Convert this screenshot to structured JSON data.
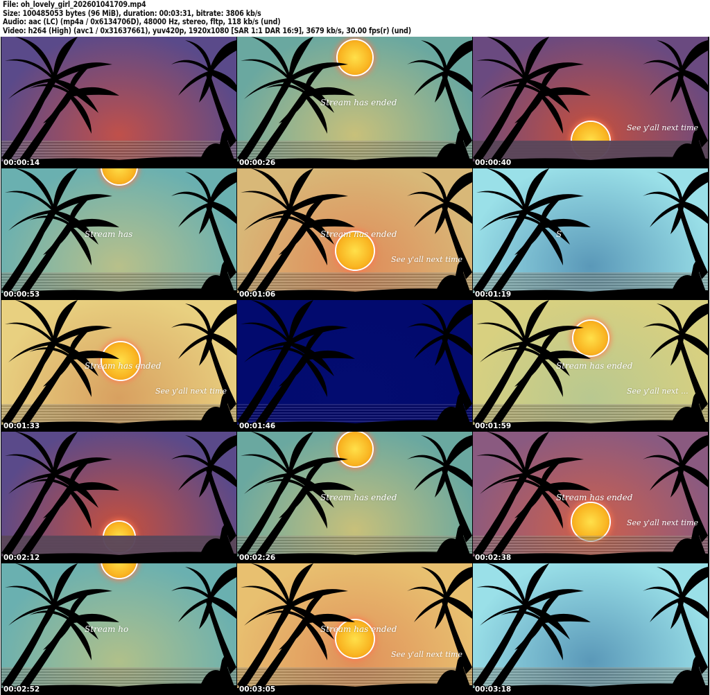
{
  "header": {
    "file": "File: oh_lovely_girl_202601041709.mp4",
    "size": "Size: 100485053 bytes (96 MiB), duration: 00:03:31, bitrate: 3806 kb/s",
    "audio": "Audio: aac (LC) (mp4a / 0x6134706D), 48000 Hz, stereo, fltp, 118 kb/s (und)",
    "video": "Video: h264 (High) (avc1 / 0x31637661), yuv420p, 1920x1080 [SAR 1:1 DAR 16:9], 3679 kb/s, 30.00 fps(r) (und)"
  },
  "thumbnails": [
    {
      "timestamp": "00:00:14",
      "caption1": "",
      "caption2": "",
      "sky": [
        "#5a4a8a",
        "#c0504a"
      ]
    },
    {
      "timestamp": "00:00:26",
      "caption1": "Stream has ended",
      "caption2": "",
      "sky": [
        "#6aa8a0",
        "#c8c07a"
      ]
    },
    {
      "timestamp": "00:00:40",
      "caption1": "",
      "caption2": "See y'all next time",
      "sky": [
        "#6a4a80",
        "#c8503c"
      ]
    },
    {
      "timestamp": "00:00:53",
      "caption1": "Stream has",
      "caption2": "",
      "sky": [
        "#6ab0b0",
        "#b8c08a"
      ]
    },
    {
      "timestamp": "00:01:06",
      "caption1": "Stream has ended",
      "caption2": "See y'all next time",
      "sky": [
        "#d8b878",
        "#e08a58"
      ]
    },
    {
      "timestamp": "00:01:19",
      "caption1": "S",
      "caption2": "",
      "sky": [
        "#9ae0e8",
        "#5a98b8"
      ]
    },
    {
      "timestamp": "00:01:33",
      "caption1": "Stream has ended",
      "caption2": "See y'all next time",
      "sky": [
        "#e8d080",
        "#d8a060"
      ]
    },
    {
      "timestamp": "00:01:46",
      "caption1": "",
      "caption2": "",
      "sky": [
        "#020a6e",
        "#030c70"
      ]
    },
    {
      "timestamp": "00:01:59",
      "caption1": "Stream has ended",
      "caption2": "See y'all next ...",
      "sky": [
        "#d8d080",
        "#b8c890"
      ]
    },
    {
      "timestamp": "00:02:12",
      "caption1": "",
      "caption2": "",
      "sky": [
        "#5a4a8a",
        "#c8503c"
      ]
    },
    {
      "timestamp": "00:02:26",
      "caption1": "Stream has ended",
      "caption2": "",
      "sky": [
        "#6aa8a0",
        "#c8c07a"
      ]
    },
    {
      "timestamp": "00:02:38",
      "caption1": "Stream has ended",
      "caption2": "See y'all next time",
      "sky": [
        "#8a5a80",
        "#d0604a"
      ]
    },
    {
      "timestamp": "00:02:52",
      "caption1": "Stream ho",
      "caption2": "",
      "sky": [
        "#6ab0b0",
        "#b0c08a"
      ]
    },
    {
      "timestamp": "00:03:05",
      "caption1": "Stream has ended",
      "caption2": "See y'all next time",
      "sky": [
        "#e8c070",
        "#e0905a"
      ]
    },
    {
      "timestamp": "00:03:18",
      "caption1": "",
      "caption2": "",
      "sky": [
        "#9ae0e8",
        "#5a98b8"
      ]
    }
  ]
}
